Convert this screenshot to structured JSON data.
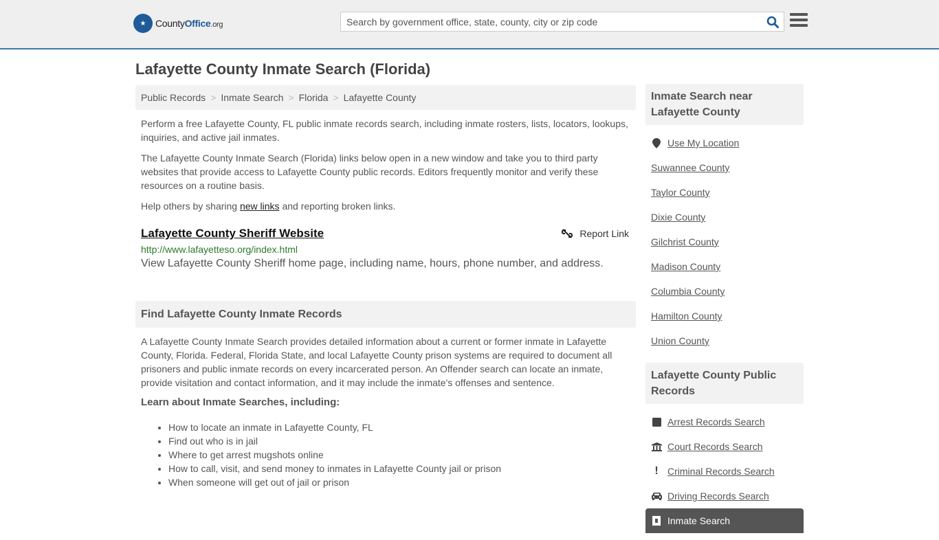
{
  "header": {
    "logo": {
      "county": "County",
      "office": "Office",
      "org": ".org"
    },
    "search_placeholder": "Search by government office, state, county, city or zip code"
  },
  "page_title": "Lafayette County Inmate Search (Florida)",
  "breadcrumb": [
    "Public Records",
    "Inmate Search",
    "Florida",
    "Lafayette County"
  ],
  "breadcrumb_sep": ">",
  "intro": {
    "p1": "Perform a free Lafayette County, FL public inmate records search, including inmate rosters, lists, locators, lookups, inquiries, and active jail inmates.",
    "p2": "The Lafayette County Inmate Search (Florida) links below open in a new window and take you to third party websites that provide access to Lafayette County public records. Editors frequently monitor and verify these resources on a routine basis.",
    "p3_before": "Help others by sharing ",
    "p3_link": "new links",
    "p3_after": " and reporting broken links."
  },
  "result": {
    "title": "Lafayette County Sheriff Website",
    "url": "http://www.lafayetteso.org/index.html",
    "description": "View Lafayette County Sheriff home page, including name, hours, phone number, and address.",
    "report_label": "Report Link"
  },
  "find_section": {
    "heading": "Find Lafayette County Inmate Records",
    "body": "A Lafayette County Inmate Search provides detailed information about a current or former inmate in Lafayette County, Florida. Federal, Florida State, and local Lafayette County prison systems are required to document all prisoners and public inmate records on every incarcerated person. An Offender search can locate an inmate, provide visitation and contact information, and it may include the inmate's offenses and sentence.",
    "learn_heading": "Learn about Inmate Searches, including:",
    "bullets": [
      "How to locate an inmate in Lafayette County, FL",
      "Find out who is in jail",
      "Where to get arrest mugshots online",
      "How to call, visit, and send money to inmates in Lafayette County jail or prison",
      "When someone will get out of jail or prison"
    ]
  },
  "sidebar": {
    "nearby_heading": "Inmate Search near Lafayette County",
    "use_location": "Use My Location",
    "nearby": [
      "Suwannee County",
      "Taylor County",
      "Dixie County",
      "Gilchrist County",
      "Madison County",
      "Columbia County",
      "Hamilton County",
      "Union County"
    ],
    "records_heading": "Lafayette County Public Records",
    "records": [
      {
        "label": "Arrest Records Search",
        "icon": "square-icon"
      },
      {
        "label": "Court Records Search",
        "icon": "courthouse-icon"
      },
      {
        "label": "Criminal Records Search",
        "icon": "exclamation-icon"
      },
      {
        "label": "Driving Records Search",
        "icon": "car-icon"
      },
      {
        "label": "Inmate Search",
        "icon": "jail-door-icon",
        "active": true
      }
    ]
  },
  "colors": {
    "brand_blue": "#1f5a99",
    "header_border": "#3a7aab",
    "url_green": "#2a7a2a"
  }
}
